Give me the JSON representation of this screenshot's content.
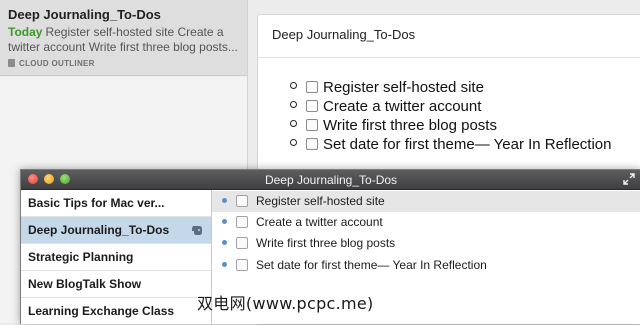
{
  "note_list": {
    "note": {
      "title": "Deep Journaling_To-Dos",
      "date": "Today",
      "snippet": "Register self-hosted site Create a twitter account Write first three blog posts...",
      "source": "CLOUD OUTLINER"
    }
  },
  "editor": {
    "title": "Deep Journaling_To-Dos",
    "todos": [
      "Register self-hosted site",
      "Create a twitter account",
      "Write first three blog posts",
      "Set date for first theme— Year In Reflection"
    ]
  },
  "window": {
    "title": "Deep Journaling_To-Dos",
    "sidebar": [
      {
        "label": "Basic Tips for Mac ver...",
        "selected": false
      },
      {
        "label": "Deep Journaling_To-Dos",
        "selected": true,
        "icon": "evernote-sync-icon"
      },
      {
        "label": "Strategic Planning",
        "selected": false
      },
      {
        "label": "New BlogTalk Show",
        "selected": false
      },
      {
        "label": "Learning Exchange Class",
        "selected": false
      }
    ],
    "outline": [
      {
        "text": "Register self-hosted site",
        "highlighted": true
      },
      {
        "text": "Create a twitter account",
        "highlighted": false
      },
      {
        "text": "Write first three blog posts",
        "highlighted": false
      },
      {
        "text": "Set date for first theme— Year In Reflection",
        "highlighted": false
      }
    ]
  },
  "watermark": "双电网(www.pcpc.me)",
  "colors": {
    "today": "#3a9a2a",
    "selection": "#c5d8ea",
    "bullet": "#5d8fc4"
  }
}
